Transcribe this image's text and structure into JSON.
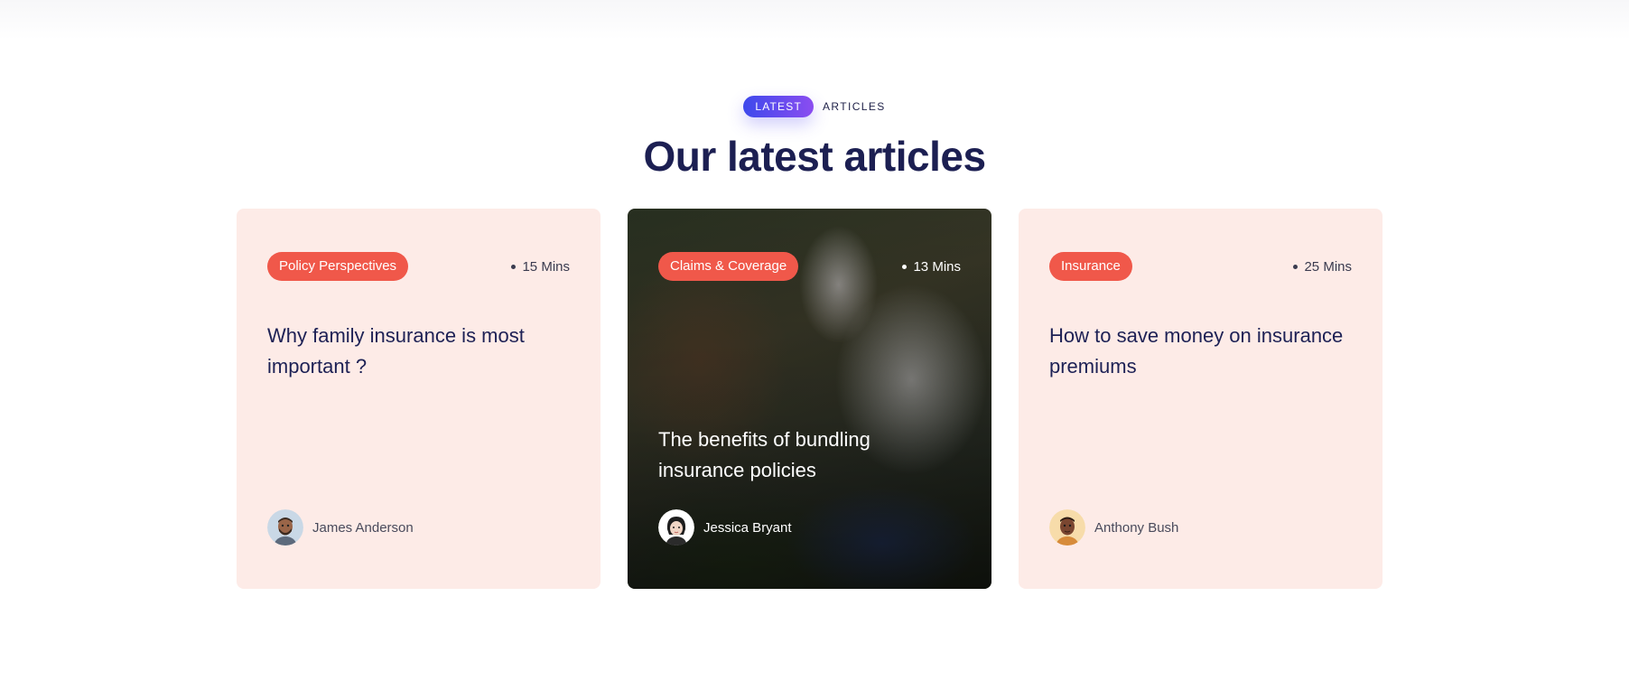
{
  "section": {
    "eyebrow_pill": "LATEST",
    "eyebrow_text": "ARTICLES",
    "heading": "Our latest articles"
  },
  "cards": [
    {
      "tag": "Policy Perspectives",
      "read_time": "15 Mins",
      "title": "Why family insurance is most important ?",
      "author": "James Anderson",
      "background": "#fdebe7"
    },
    {
      "tag": "Claims & Coverage",
      "read_time": "13 Mins",
      "title": "The benefits of bundling insurance policies",
      "author": "Jessica Bryant",
      "background": "photo"
    },
    {
      "tag": "Insurance",
      "read_time": "25 Mins",
      "title": "How to save money on insurance premiums",
      "author": "Anthony Bush",
      "background": "#fdebe7"
    }
  ],
  "colors": {
    "heading": "#1c1f52",
    "tag": "#f0584a",
    "card_bg": "#fdebe7",
    "pill_start": "#3d49ec",
    "pill_end": "#8b4df0"
  }
}
